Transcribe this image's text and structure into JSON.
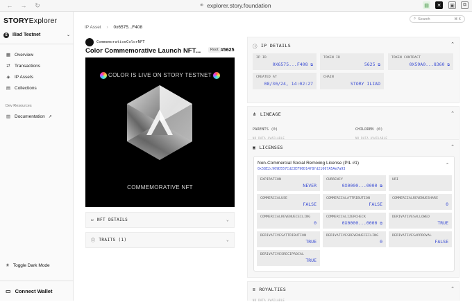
{
  "browser": {
    "url": "explorer.story.foundation",
    "back_icon": "arrow-left-icon",
    "forward_icon": "arrow-right-icon",
    "reload_icon": "reload-icon"
  },
  "sidebar": {
    "brand_bold": "STORY",
    "brand_thin": "Explorer",
    "network": "Iliad Testnet",
    "items": [
      {
        "label": "Overview",
        "icon": "grid-icon"
      },
      {
        "label": "Transactions",
        "icon": "swap-icon"
      },
      {
        "label": "IP Assets",
        "icon": "ip-icon"
      },
      {
        "label": "Collections",
        "icon": "collections-icon"
      }
    ],
    "section_label": "Dev Resources",
    "documentation": "Documentation",
    "dark_mode": "Toggle Dark Mode",
    "connect_wallet": "Connect Wallet"
  },
  "header": {
    "breadcrumb_root": "IP Asset",
    "breadcrumb_current": "0x6575...F408",
    "search_placeholder": "Search",
    "search_shortcut": "⌘ K"
  },
  "asset": {
    "collection": "CommemorativeColorNFT",
    "title": "Color Commemorative Launch NFT...",
    "root_badge": "Root",
    "token_number": "#5625",
    "art_top_text": "COLOR IS LIVE ON STORY TESTNET",
    "art_bottom_text": "COMMEMORATIVE NFT",
    "nft_details_label": "NFT DETAILS",
    "traits_label": "TRAITS",
    "traits_count": "(1)"
  },
  "ip_details": {
    "title": "IP DETAILS",
    "fields": [
      {
        "label": "IP ID",
        "value": "0X6575...F408"
      },
      {
        "label": "TOKEN ID",
        "value": "5625"
      },
      {
        "label": "TOKEN CONTRACT",
        "value": "0X59A0...8360"
      },
      {
        "label": "CREATED AT",
        "value": "08/30/24, 14:02:27"
      },
      {
        "label": "CHAIN",
        "value": "STORY ILIAD"
      }
    ]
  },
  "lineage": {
    "title": "LINEAGE",
    "parents_label": "PARENTS (0)",
    "children_label": "CHILDREN (0)",
    "no_data": "NO DATA AVAILABLE"
  },
  "licenses": {
    "title": "LICENSES",
    "license_name": "Non-Commercial Social Remixing License (PIL #1)",
    "license_hash": "0x58E2c909D557Cd23EF90D14f8fd21667A5Ae7a93",
    "fields": [
      {
        "label": "EXPIRATION",
        "value": "NEVER"
      },
      {
        "label": "CURRENCY",
        "value": "0X0000...0000"
      },
      {
        "label": "URI",
        "value": ""
      },
      {
        "label": "COMMERCIALUSE",
        "value": "FALSE"
      },
      {
        "label": "COMMERCIALATTRIBUTION",
        "value": "FALSE"
      },
      {
        "label": "COMMERCIALREVENUESHARE",
        "value": "0"
      },
      {
        "label": "COMMERCIALREVENUECEILING",
        "value": "0"
      },
      {
        "label": "COMMERCIALIZERCHECK",
        "value": "0X0000...0000"
      },
      {
        "label": "DERIVATIVESALLOWED",
        "value": "TRUE"
      },
      {
        "label": "DERIVATIVESATTRIBUTION",
        "value": "TRUE"
      },
      {
        "label": "DERIVATIVESREVENUECEILING",
        "value": "0"
      },
      {
        "label": "DERIVATIVESAPPROVAL",
        "value": "FALSE"
      },
      {
        "label": "DERIVATIVESRECIPROCAL",
        "value": "TRUE"
      }
    ]
  },
  "royalties": {
    "title": "ROYALTIES",
    "no_data": "NO DATA AVAILABLE"
  },
  "colors": {
    "accent_blue": "#3d4fd4",
    "panel_bg": "#f7f7f7",
    "field_bg": "#ebebeb"
  }
}
